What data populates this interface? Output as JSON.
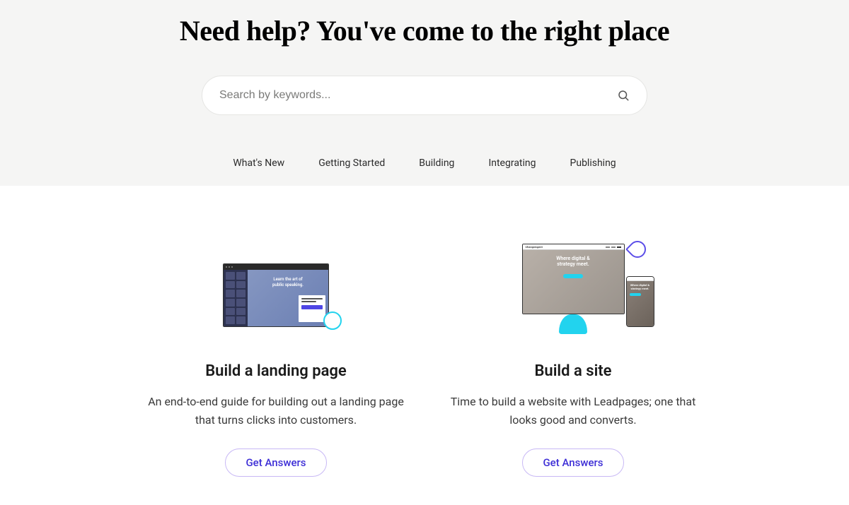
{
  "hero": {
    "title": "Need help? You've come to the right place"
  },
  "search": {
    "placeholder": "Search by keywords..."
  },
  "nav": {
    "items": [
      {
        "label": "What's New"
      },
      {
        "label": "Getting Started"
      },
      {
        "label": "Building"
      },
      {
        "label": "Integrating"
      },
      {
        "label": "Publishing"
      }
    ]
  },
  "cards": [
    {
      "title": "Build a landing page",
      "description": "An end-to-end guide for building out a landing page that turns clicks into customers.",
      "cta": "Get Answers",
      "mock": {
        "headline1": "Learn the art of",
        "headline2": "public speaking."
      }
    },
    {
      "title": "Build a site",
      "description": "Time to build a website with Leadpages; one that looks good and converts.",
      "cta": "Get Answers",
      "mock": {
        "brand": "ChangeAgent",
        "headline1": "Where digital &",
        "headline2": "strategy meet.",
        "phone_headline1": "Where digital &",
        "phone_headline2": "strategy meet."
      }
    }
  ]
}
